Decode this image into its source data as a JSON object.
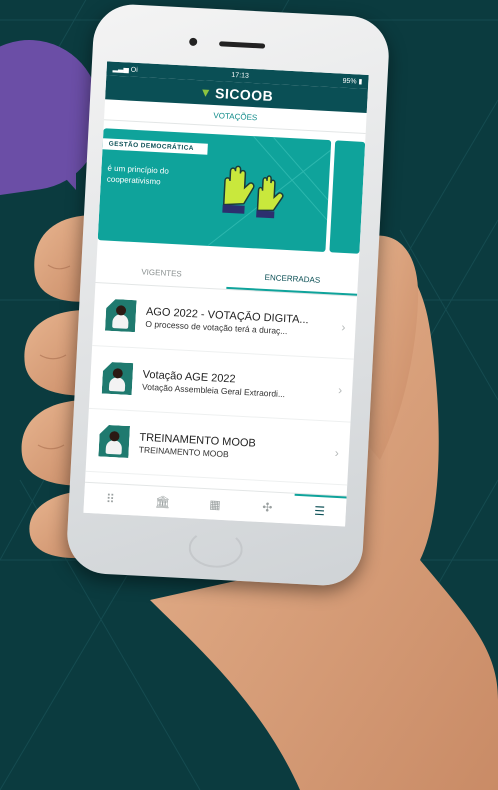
{
  "status_bar": {
    "carrier": "Oi",
    "time": "17:13",
    "battery": "95%"
  },
  "header": {
    "brand": "SICOOB",
    "section_title": "VOTAÇÕES"
  },
  "banner": {
    "tag": "GESTÃO DEMOCRÁTICA",
    "text": "é um princípio do cooperativismo"
  },
  "tabs": [
    {
      "label": "VIGENTES",
      "active": false
    },
    {
      "label": "ENCERRADAS",
      "active": true
    }
  ],
  "items": [
    {
      "title": "AGO 2022 - VOTAÇÃO DIGITA...",
      "subtitle": "O processo de votação terá a duraç..."
    },
    {
      "title": "Votação AGE 2022",
      "subtitle": "Votação Assembleia Geral Extraordi..."
    },
    {
      "title": "TREINAMENTO MOOB",
      "subtitle": "TREINAMENTO MOOB"
    }
  ],
  "bottom_nav": [
    {
      "icon": "grid-icon",
      "glyph": "⠿",
      "active": false
    },
    {
      "icon": "bank-icon",
      "glyph": "🏛",
      "active": false
    },
    {
      "icon": "calendar-icon",
      "glyph": "▦",
      "active": false
    },
    {
      "icon": "handshake-icon",
      "glyph": "✣",
      "active": false
    },
    {
      "icon": "menu-icon",
      "glyph": "☰",
      "active": true
    }
  ],
  "colors": {
    "background": "#0b3b3f",
    "brand_teal": "#0fa39b",
    "header_dark": "#0a4f55",
    "accent_green": "#8cc43f",
    "purple_bubble": "#6b4ea6"
  }
}
